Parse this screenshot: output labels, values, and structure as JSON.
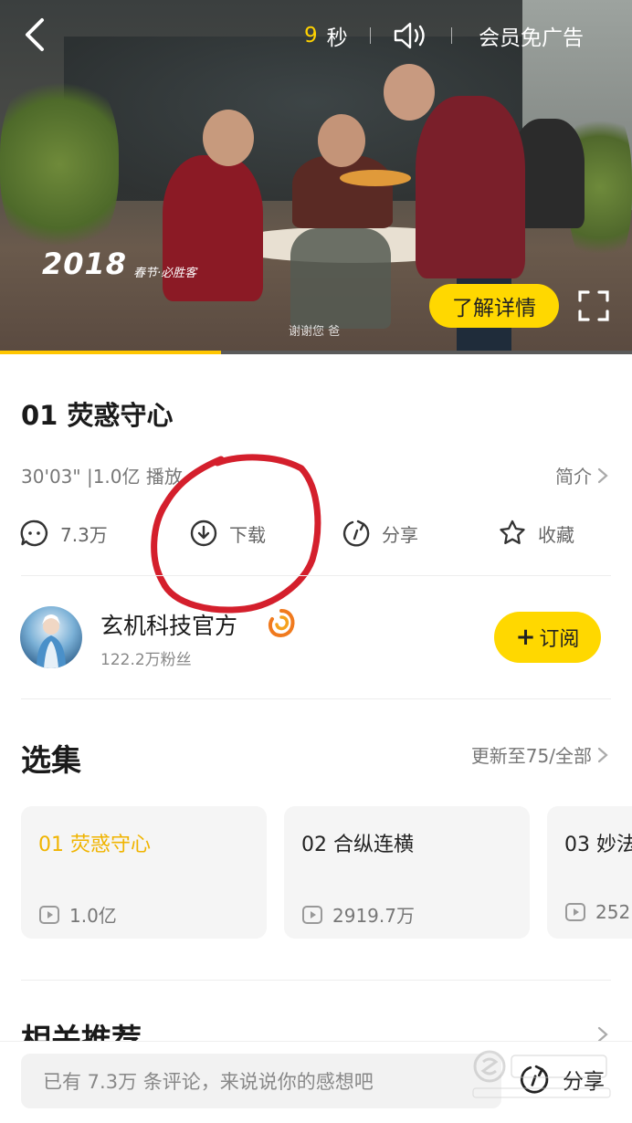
{
  "player": {
    "countdown": "9",
    "countdown_unit": "秒",
    "vip_ad_free": "会员免广告",
    "ad_year": "2018",
    "ad_slogan": "春节·必胜客",
    "ad_subtitle": "谢谢您 爸",
    "learn_more": "了解详情",
    "progress": 0.35,
    "accent_color": "#ffd800"
  },
  "video": {
    "title": "01 荧惑守心",
    "meta": "30'03\" |1.0亿 播放",
    "intro_label": "简介"
  },
  "actions": {
    "comments": "7.3万",
    "download": "下载",
    "share": "分享",
    "favorite": "收藏"
  },
  "channel": {
    "name": "玄机科技官方",
    "fans": "122.2万粉丝",
    "subscribe_label": "订阅"
  },
  "episodes": {
    "section_title": "选集",
    "update_label": "更新至75/全部",
    "items": [
      {
        "title": "01 荧惑守心",
        "plays": "1.0亿",
        "active": true
      },
      {
        "title": "02 合纵连横",
        "plays": "2919.7万",
        "active": false
      },
      {
        "title": "03 妙法",
        "plays": "252",
        "active": false
      }
    ]
  },
  "related": {
    "title": "相关推荐"
  },
  "bottom": {
    "comment_placeholder": "已有 7.3万 条评论，来说说你的感想吧",
    "share_label": "分享"
  },
  "icons": {
    "back": "back-arrow-icon",
    "volume": "volume-icon",
    "fullscreen": "fullscreen-icon",
    "comment": "comment-icon",
    "download": "download-icon",
    "share": "share-icon",
    "favorite": "star-icon",
    "verified": "verified-badge-icon",
    "play_count": "play-count-icon"
  }
}
